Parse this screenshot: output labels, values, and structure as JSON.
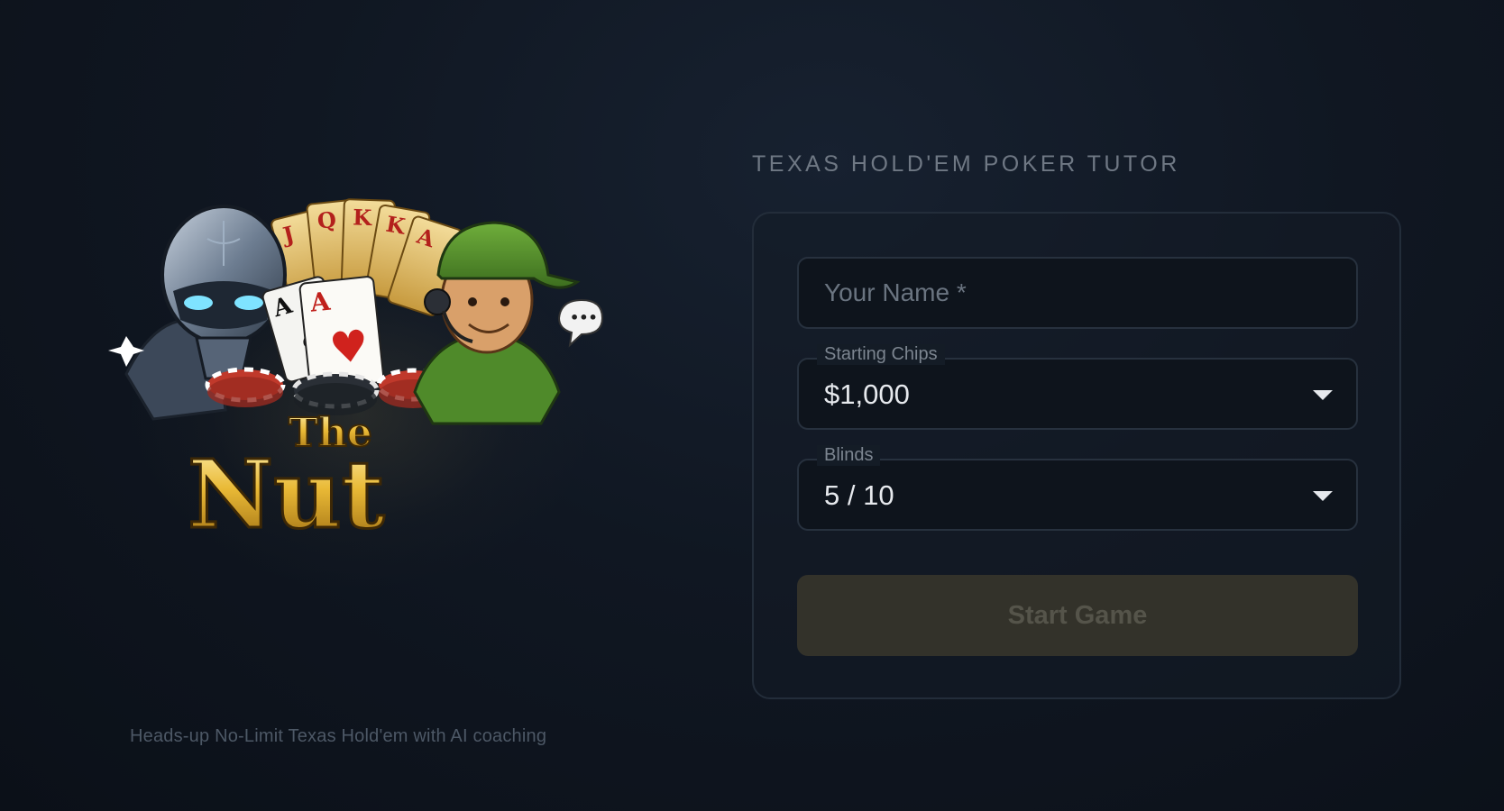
{
  "app": {
    "subtitle": "TEXAS HOLD'EM POKER TUTOR",
    "tagline": "Heads-up No-Limit Texas Hold'em with AI coaching"
  },
  "logo": {
    "line1": "The",
    "line2": "Nut",
    "cards_back": [
      "J",
      "Q",
      "K",
      "K",
      "A"
    ],
    "cards_front": [
      "A",
      "A"
    ],
    "speech_bubble": "•••"
  },
  "form": {
    "name_placeholder": "Your Name *",
    "name_value": "",
    "chips_label": "Starting Chips",
    "chips_value": "$1,000",
    "blinds_label": "Blinds",
    "blinds_value": "5 / 10",
    "start_label": "Start Game"
  },
  "colors": {
    "gold": "#e9b936",
    "start_button_disabled": "#33322a",
    "chip_red": "#c0392b"
  }
}
